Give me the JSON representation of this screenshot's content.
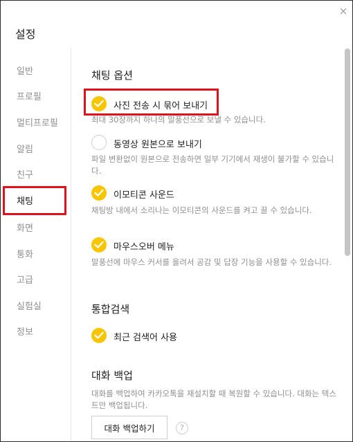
{
  "window": {
    "title": "설정",
    "close_glyph": "×"
  },
  "sidebar": {
    "items": [
      {
        "label": "일반",
        "active": false
      },
      {
        "label": "프로필",
        "active": false
      },
      {
        "label": "멀티프로필",
        "active": false
      },
      {
        "label": "알림",
        "active": false
      },
      {
        "label": "친구",
        "active": false
      },
      {
        "label": "채팅",
        "active": true
      },
      {
        "label": "화면",
        "active": false
      },
      {
        "label": "통화",
        "active": false
      },
      {
        "label": "고급",
        "active": false
      },
      {
        "label": "실험실",
        "active": false
      },
      {
        "label": "정보",
        "active": false
      }
    ]
  },
  "chat_options": {
    "title": "채팅 옵션",
    "photo_bundle": {
      "label": "사진 전송 시 묶어 보내기",
      "checked": true,
      "desc": "최대 30장까지 하나의 말풍선으로 보낼 수 있습니다."
    },
    "video_original": {
      "label": "동영상 원본으로 보내기",
      "checked": false,
      "desc": "파일 변환없이 원본으로 전송하면 일부 기기에서 재생이 불가할 수 있습니다."
    },
    "emoticon_sound": {
      "label": "이모티콘 사운드",
      "checked": true,
      "desc": "채팅방 내에서 소리나는 이모티콘의 사운드를 켜고 끌 수 있습니다."
    },
    "mouseover_menu": {
      "label": "마우스오버 메뉴",
      "checked": true,
      "desc": "말풍선에 마우스 커서를 올려서 공감 및 답장 기능을 사용할 수 있습니다."
    }
  },
  "search": {
    "title": "통합검색",
    "recent_keywords": {
      "label": "최근 검색어 사용",
      "checked": true
    }
  },
  "backup": {
    "title": "대화 백업",
    "desc": "대화를 백업하여 카카오톡을 재설치할 때 복원할 수 있습니다. 대화는 텍스트만 백업됩니다.",
    "button_label": "대화 백업하기",
    "help_glyph": "?"
  },
  "colors": {
    "accent": "#f7c600",
    "highlight": "#e0111b",
    "muted_text": "#8f8f8f"
  }
}
